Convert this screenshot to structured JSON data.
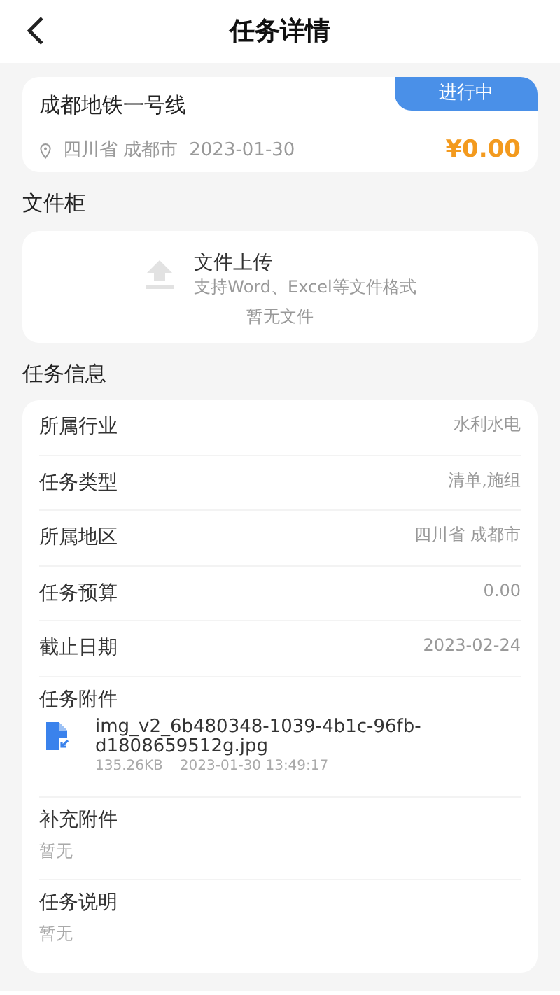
{
  "header": {
    "title": "任务详情"
  },
  "task": {
    "name": "成都地铁一号线",
    "status": "进行中",
    "location": "四川省 成都市",
    "date": "2023-01-30",
    "amount": "¥0.00"
  },
  "file_cabinet": {
    "heading": "文件柜",
    "upload_title": "文件上传",
    "upload_hint": "支持Word、Excel等文件格式",
    "empty_text": "暂无文件"
  },
  "task_info": {
    "heading": "任务信息",
    "rows": [
      {
        "kind": "inline",
        "label": "所属行业",
        "value": "水利水电"
      },
      {
        "kind": "inline",
        "label": "任务类型",
        "value": "清单,施组"
      },
      {
        "kind": "inline",
        "label": "所属地区",
        "value": "四川省 成都市"
      },
      {
        "kind": "inline",
        "label": "任务预算",
        "value": "0.00"
      },
      {
        "kind": "inline",
        "label": "截止日期",
        "value": "2023-02-24"
      },
      {
        "kind": "files",
        "label": "任务附件",
        "files": [
          {
            "name": "img_v2_6b480348-1039-4b1c-96fb-d1808659512g.jpg",
            "size": "135.26KB",
            "time": "2023-01-30 13:49:17"
          }
        ]
      },
      {
        "kind": "stacked",
        "label": "补充附件",
        "value": "暂无"
      },
      {
        "kind": "stacked",
        "label": "任务说明",
        "value": "暂无"
      }
    ]
  }
}
